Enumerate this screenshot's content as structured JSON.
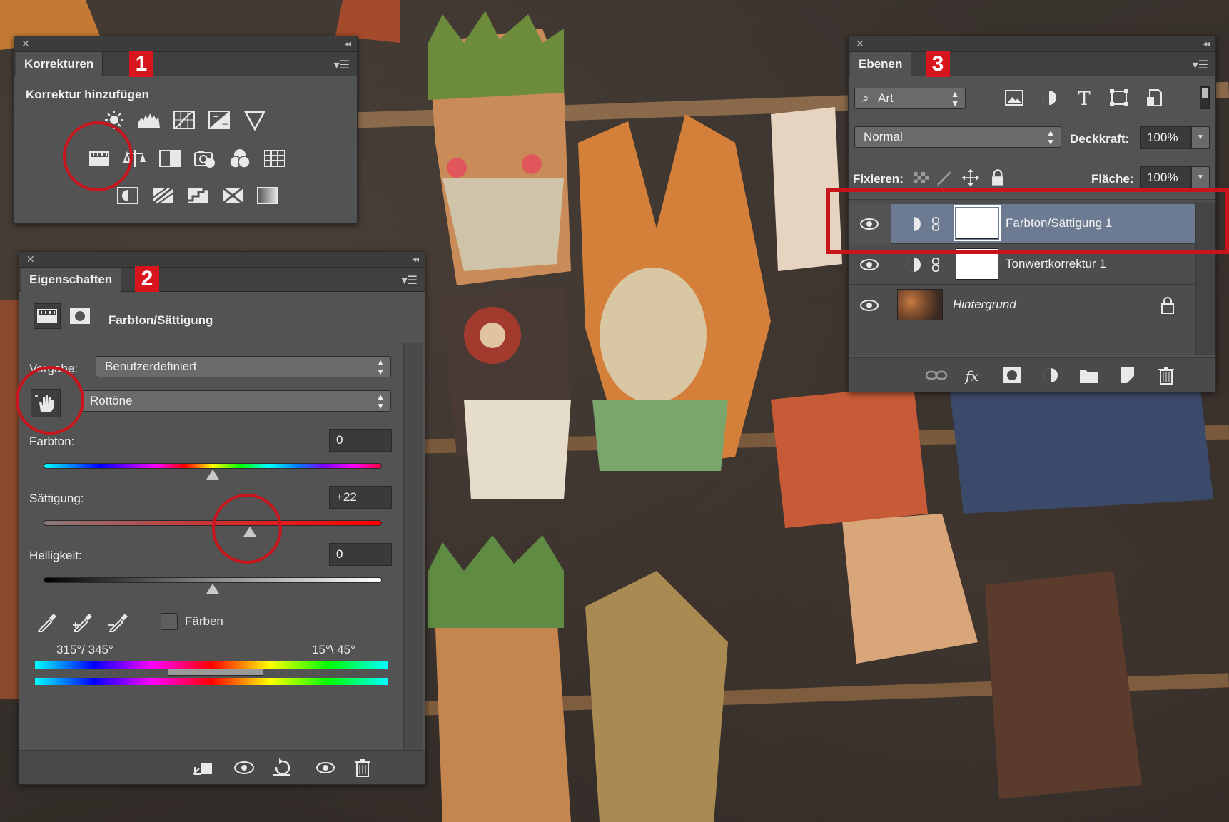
{
  "korrekturen": {
    "tab": "Korrekturen",
    "badge": "1",
    "heading": "Korrektur hinzufügen",
    "icons_row1": [
      "brightness-contrast-icon",
      "levels-icon",
      "curves-icon",
      "exposure-icon",
      "vibrance-icon"
    ],
    "icons_row2": [
      "hue-saturation-icon",
      "color-balance-icon",
      "black-white-icon",
      "photo-filter-icon",
      "channel-mixer-icon",
      "color-lookup-icon"
    ],
    "icons_row3": [
      "invert-icon",
      "posterize-icon",
      "threshold-icon",
      "selective-color-icon",
      "gradient-map-icon"
    ]
  },
  "eigenschaften": {
    "tab": "Eigenschaften",
    "badge": "2",
    "title": "Farbton/Sättigung",
    "preset_label": "Vorgabe:",
    "preset_value": "Benutzerdefiniert",
    "channel_value": "Rottöne",
    "hue": {
      "label": "Farbton:",
      "value": "0",
      "level": 0.5
    },
    "saturation": {
      "label": "Sättigung:",
      "value": "+22",
      "level": 0.61
    },
    "lightness": {
      "label": "Helligkeit:",
      "value": "0",
      "level": 0.5
    },
    "colorize_label": "Färben",
    "range_left": "315°/ 345°",
    "range_right": "15°\\ 45°"
  },
  "ebenen": {
    "tab": "Ebenen",
    "badge": "3",
    "filter_label": "Art",
    "blend_mode": "Normal",
    "opacity_label": "Deckkraft:",
    "opacity_value": "100%",
    "lock_label": "Fixieren:",
    "fill_label": "Fläche:",
    "fill_value": "100%",
    "layers": [
      {
        "name": "Farbton/Sättigung 1",
        "selected": true
      },
      {
        "name": "Tonwertkorrektur 1",
        "selected": false
      },
      {
        "name": "Hintergrund",
        "selected": false
      }
    ]
  },
  "colors": {
    "accent_red": "#d8151c",
    "panel_bg": "#535353",
    "selected_layer": "#6c7a92"
  }
}
